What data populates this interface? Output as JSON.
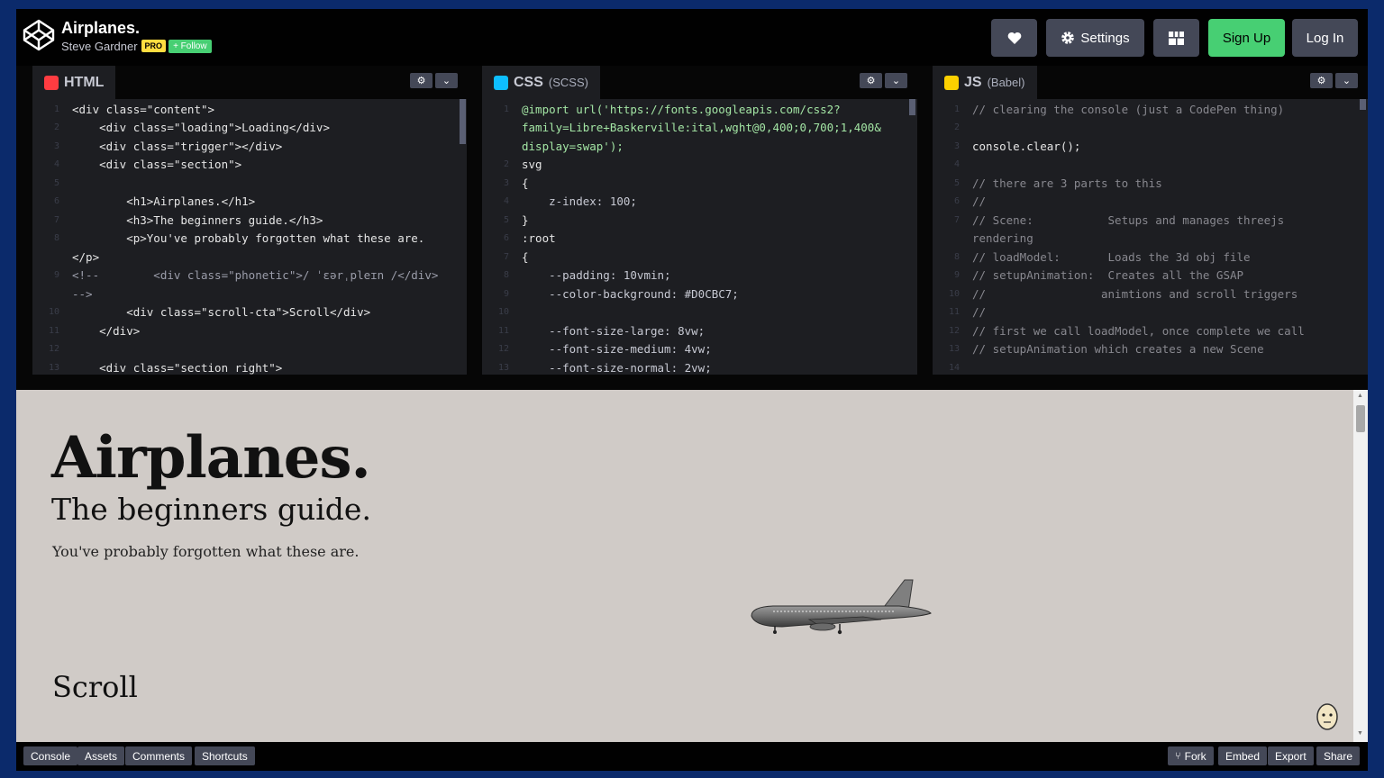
{
  "header": {
    "pen_title": "Airplanes.",
    "author": "Steve Gardner",
    "pro_badge": "PRO",
    "follow_label": "+ Follow",
    "settings_label": "Settings",
    "signup_label": "Sign Up",
    "login_label": "Log In"
  },
  "editors": {
    "html": {
      "label": "HTML",
      "lines": [
        [
          "1",
          "<div class=\"content\">"
        ],
        [
          "2",
          "    <div class=\"loading\">Loading</div>"
        ],
        [
          "3",
          "    <div class=\"trigger\"></div>"
        ],
        [
          "4",
          "    <div class=\"section\">"
        ],
        [
          "5",
          ""
        ],
        [
          "6",
          "        <h1>Airplanes.</h1>"
        ],
        [
          "7",
          "        <h3>The beginners guide.</h3>"
        ],
        [
          "8",
          "        <p>You've probably forgotten what these are."
        ],
        [
          "",
          "</p>"
        ],
        [
          "9",
          "<!--        <div class=\"phonetic\">/ ˈɛərˌpleɪn /</div>"
        ],
        [
          "",
          "-->"
        ],
        [
          "10",
          "        <div class=\"scroll-cta\">Scroll</div>"
        ],
        [
          "11",
          "    </div>"
        ],
        [
          "12",
          ""
        ],
        [
          "13",
          "    <div class=\"section right\">"
        ]
      ]
    },
    "css": {
      "label": "CSS",
      "sub": "(SCSS)",
      "lines": [
        [
          "1",
          "@import url('https://fonts.googleapis.com/css2?"
        ],
        [
          "",
          "family=Libre+Baskerville:ital,wght@0,400;0,700;1,400&"
        ],
        [
          "",
          "display=swap');"
        ],
        [
          "2",
          "svg"
        ],
        [
          "3",
          "{"
        ],
        [
          "4",
          "    z-index: 100;"
        ],
        [
          "5",
          "}"
        ],
        [
          "6",
          ":root"
        ],
        [
          "7",
          "{"
        ],
        [
          "8",
          "    --padding: 10vmin;"
        ],
        [
          "9",
          "    --color-background: #D0CBC7;"
        ],
        [
          "10",
          ""
        ],
        [
          "11",
          "    --font-size-large: 8vw;"
        ],
        [
          "12",
          "    --font-size-medium: 4vw;"
        ],
        [
          "13",
          "    --font-size-normal: 2vw;"
        ]
      ]
    },
    "js": {
      "label": "JS",
      "sub": "(Babel)",
      "lines": [
        [
          "1",
          "// clearing the console (just a CodePen thing)"
        ],
        [
          "2",
          ""
        ],
        [
          "3",
          "console.clear();"
        ],
        [
          "4",
          ""
        ],
        [
          "5",
          "// there are 3 parts to this"
        ],
        [
          "6",
          "//"
        ],
        [
          "7",
          "// Scene:           Setups and manages threejs"
        ],
        [
          "",
          "rendering"
        ],
        [
          "8",
          "// loadModel:       Loads the 3d obj file"
        ],
        [
          "9",
          "// setupAnimation:  Creates all the GSAP"
        ],
        [
          "10",
          "//                 animtions and scroll triggers"
        ],
        [
          "11",
          "//"
        ],
        [
          "12",
          "// first we call loadModel, once complete we call"
        ],
        [
          "13",
          "// setupAnimation which creates a new Scene"
        ],
        [
          "14",
          ""
        ]
      ]
    }
  },
  "preview": {
    "h1": "Airplanes.",
    "h3": "The beginners guide.",
    "paragraph": "You've probably forgotten what these are.",
    "scroll_cta": "Scroll",
    "background": "#D0CBC7"
  },
  "footer": {
    "left": [
      "Console",
      "Assets",
      "Comments",
      "Shortcuts"
    ],
    "right": [
      "Fork",
      "Embed",
      "Export",
      "Share"
    ]
  },
  "colors": {
    "accent_green": "#47CF73",
    "pro_yellow": "#FFDD40",
    "button_gray": "#444857"
  }
}
